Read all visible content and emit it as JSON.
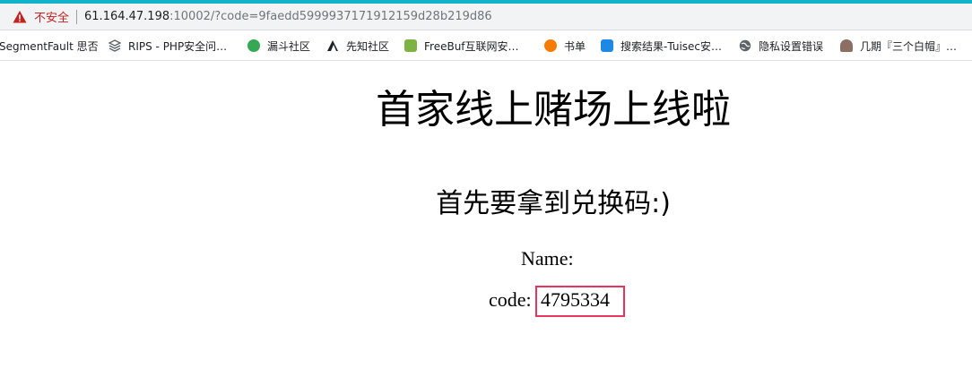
{
  "browser": {
    "insecure_label": "不安全",
    "url_host": "61.164.47.198",
    "url_rest": ":10002/?code=9faedd5999937171912159d28b219d86"
  },
  "bookmarks": [
    {
      "label": "SegmentFault 思否",
      "icon": "none"
    },
    {
      "label": "RIPS - PHP安全问…",
      "icon": "rips-icon",
      "color": "#5f6368"
    },
    {
      "label": "漏斗社区",
      "icon": "leaf-icon",
      "color": "#34a853"
    },
    {
      "label": "先知社区",
      "icon": "xianzhi-icon",
      "color": "#202124"
    },
    {
      "label": "FreeBuf互联网安…",
      "icon": "freebuf-icon",
      "color": "#7cb342"
    },
    {
      "label": "书单",
      "icon": "book-icon",
      "color": "#f57c00"
    },
    {
      "label": "搜索结果-Tuisec安…",
      "icon": "tuisec-icon",
      "color": "#1e88e5"
    },
    {
      "label": "隐私设置错误",
      "icon": "globe-icon",
      "color": "#5f6368"
    },
    {
      "label": "几期『三个白帽』…",
      "icon": "hat-icon",
      "color": "#8d6e63"
    }
  ],
  "page": {
    "title": "首家线上赌场上线啦",
    "subtitle": "首先要拿到兑换码:)",
    "name_label": "Name:",
    "code_label": "code:",
    "code_value": "4795334"
  },
  "colors": {
    "highlight_box": "#e8355d",
    "top_accent": "#12b3c9"
  }
}
